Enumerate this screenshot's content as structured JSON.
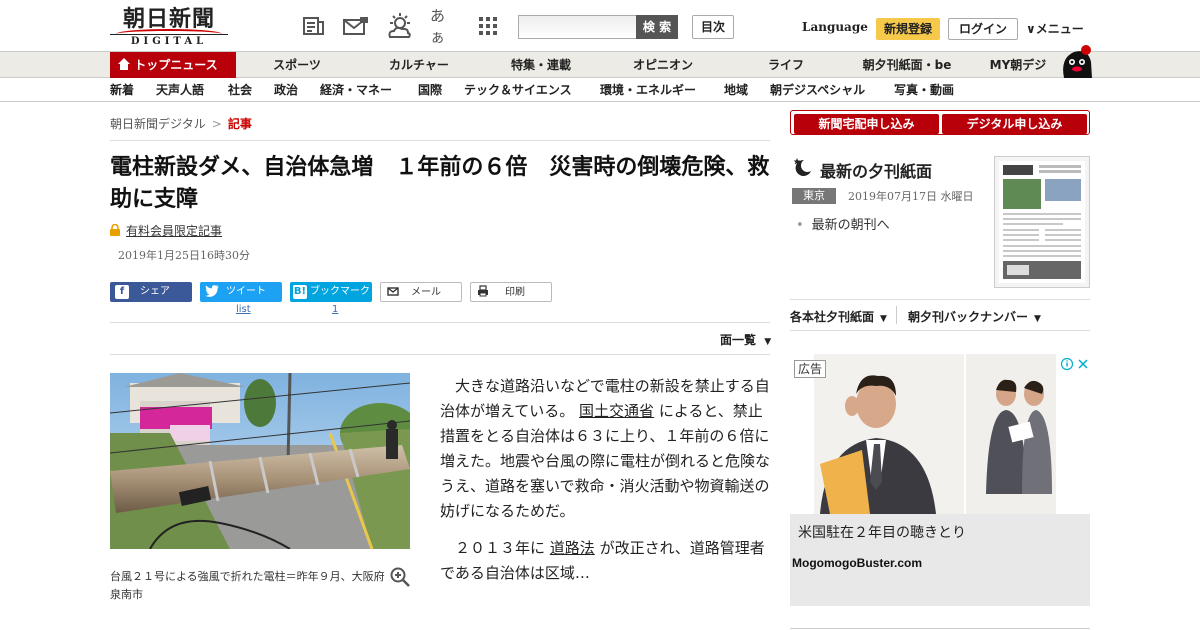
{
  "header": {
    "logo_jp": "朝日新聞",
    "logo_en": "DIGITAL",
    "search_placeholder": "",
    "search_button": "検 索",
    "toc_button": "目次",
    "language": "Language",
    "register": "新規登録",
    "login": "ログイン",
    "menu": "メニュー",
    "icons": [
      "newspaper-icon",
      "news-mail-icon",
      "weather-icon",
      "font-size-icon",
      "apps-grid-icon"
    ],
    "font_size_glyph": "あぁ"
  },
  "nav_main": {
    "top": "トップニュース",
    "items": [
      "スポーツ",
      "カルチャー",
      "特集・連載",
      "オピニオン",
      "ライフ",
      "朝夕刊紙面・be",
      "MY朝デジ"
    ]
  },
  "nav_sub": {
    "items": [
      "新着",
      "天声人語",
      "社会",
      "政治",
      "経済・マネー",
      "国際",
      "テック＆サイエンス",
      "環境・エネルギー",
      "地域",
      "朝デジスペシャル",
      "写真・動画"
    ]
  },
  "breadcrumb": {
    "home": "朝日新聞デジタル",
    "sep": ">",
    "current": "記事"
  },
  "article": {
    "headline": "電柱新設ダメ、自治体急増　１年前の６倍　災害時の倒壊危険、救助に支障",
    "member_only": "有料会員限定記事",
    "date": "2019年1月25日16時30分",
    "share": {
      "facebook": "シェア",
      "twitter": "ツイート",
      "twitter_count": "list",
      "hatena": "ブックマーク",
      "hatena_count": "1",
      "mail": "メール",
      "print": "印刷"
    },
    "page_list": "面一覧",
    "caption": "台風２１号による強風で折れた電柱＝昨年９月、大阪府泉南市",
    "p1_a": "大きな道路沿いなどで電柱の新設を禁止する自治体が増えている。",
    "p1_link": "国土交通省",
    "p1_b": "によると、禁止措置をとる自治体は６３に上り、１年前の６倍に増えた。地震や台風の際に電柱が倒れると危険なうえ、道路を塞いで救命・消火活動や物資輸送の妨げになるためだ。",
    "p2_a": "２０１３年に",
    "p2_link": "道路法",
    "p2_b": "が改正され、道路管理者である自治体は区域…"
  },
  "sidebar": {
    "sub_home": "新聞宅配申し込み",
    "sub_digital": "デジタル申し込み",
    "evening_title": "最新の夕刊紙面",
    "tokyo": "東京",
    "evening_date": "2019年07月17日 水曜日",
    "morning_link": "最新の朝刊へ",
    "branch_link": "各本社夕刊紙面",
    "backnumber_link": "朝夕刊バックナンバー",
    "ad_badge": "広告",
    "ad_title": "米国駐在２年目の聴きとり",
    "ad_domain": "MogomogoBuster.com"
  },
  "colors": {
    "brand_red": "#b8000a",
    "register_yellow": "#f6c94a",
    "facebook": "#3b5998",
    "twitter": "#1da1f2",
    "hatena": "#00a4de"
  }
}
